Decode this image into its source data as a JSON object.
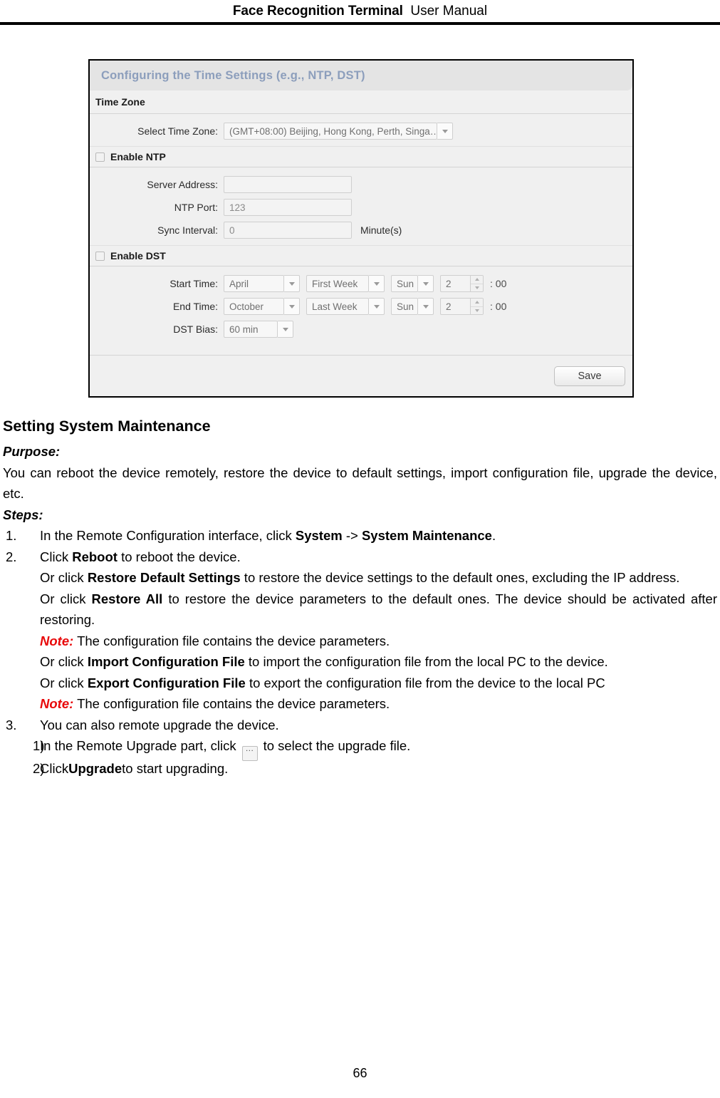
{
  "header": {
    "title_bold": "Face Recognition Terminal",
    "title_normal": "User Manual"
  },
  "figure": {
    "dialog_title": "Configuring the Time Settings (e.g., NTP, DST)",
    "time_zone_section": {
      "heading": "Time Zone",
      "select_time_zone_label": "Select Time Zone:",
      "select_time_zone_value": "(GMT+08:00) Beijing, Hong Kong, Perth, Singa…"
    },
    "ntp": {
      "enable_label": "Enable NTP",
      "enabled": false,
      "server_address_label": "Server Address:",
      "server_address_value": "",
      "ntp_port_label": "NTP Port:",
      "ntp_port_value": "123",
      "sync_interval_label": "Sync Interval:",
      "sync_interval_value": "0",
      "sync_interval_unit": "Minute(s)"
    },
    "dst": {
      "enable_label": "Enable DST",
      "enabled": false,
      "start_time_label": "Start Time:",
      "start_month": "April",
      "start_week": "First Week",
      "start_day": "Sun",
      "start_hour": "2",
      "start_minute": ": 00",
      "end_time_label": "End Time:",
      "end_month": "October",
      "end_week": "Last Week",
      "end_day": "Sun",
      "end_hour": "2",
      "end_minute": ": 00",
      "dst_bias_label": "DST Bias:",
      "dst_bias_value": "60 min"
    },
    "save_button": "Save"
  },
  "content": {
    "heading": "Setting System Maintenance",
    "purpose_label": "Purpose:",
    "purpose_text": "You can reboot the device remotely, restore the device to default settings, import configuration file, upgrade the device, etc.",
    "steps_label": "Steps:",
    "step1": {
      "num": "1.",
      "t1": "In the Remote Configuration interface, click ",
      "b1": "System",
      "t2": " -> ",
      "b2": "System Maintenance",
      "t3": "."
    },
    "step2": {
      "num": "2.",
      "t1": "Click ",
      "b1": "Reboot",
      "t2": " to reboot the device.",
      "p2_t1": "Or click ",
      "p2_b1": "Restore Default Settings",
      "p2_t2": " to restore the device settings to the default ones, excluding the IP address.",
      "p3_t1": "Or click ",
      "p3_b1": "Restore All",
      "p3_t2": " to restore the device parameters to the default ones. The device should be activated after restoring.",
      "note1_label": "Note:",
      "note1_text": " The configuration file contains the device parameters.",
      "p4_t1": "Or click ",
      "p4_b1": "Import Configuration File",
      "p4_t2": " to import the configuration file from the local PC to the device.",
      "p5_t1": "Or click ",
      "p5_b1": "Export Configuration File",
      "p5_t2": " to export the configuration file from the device to the local PC",
      "note2_label": "Note:",
      "note2_text": " The configuration file contains the device parameters."
    },
    "step3": {
      "num": "3.",
      "text": "You can also remote upgrade the device.",
      "sub1": {
        "num": "1)",
        "t1": "In the Remote Upgrade part, click",
        "icon": "…",
        "t2": "to select the upgrade file."
      },
      "sub2": {
        "num": "2)",
        "t1": "Click ",
        "b1": "Upgrade",
        "t2": " to start upgrading."
      }
    }
  },
  "footer": {
    "page_number": "66"
  }
}
